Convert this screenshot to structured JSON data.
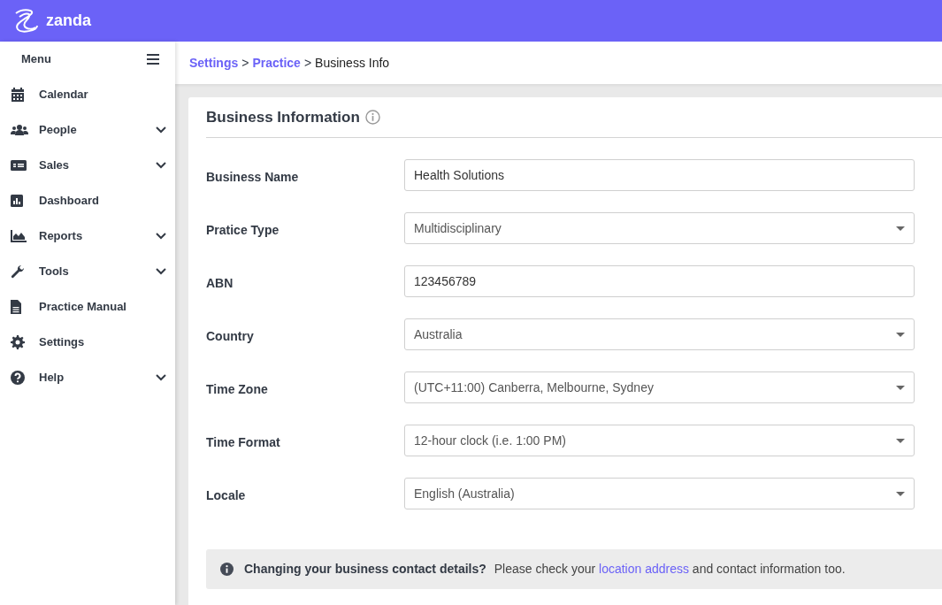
{
  "app": {
    "logo_text": "zanda"
  },
  "sidebar": {
    "title": "Menu",
    "items": [
      {
        "label": "Calendar",
        "kind": "link"
      },
      {
        "label": "People",
        "kind": "group"
      },
      {
        "label": "Sales",
        "kind": "group"
      },
      {
        "label": "Dashboard",
        "kind": "link"
      },
      {
        "label": "Reports",
        "kind": "group"
      },
      {
        "label": "Tools",
        "kind": "group"
      },
      {
        "label": "Practice Manual",
        "kind": "link"
      },
      {
        "label": "Settings",
        "kind": "link"
      },
      {
        "label": "Help",
        "kind": "group"
      }
    ]
  },
  "breadcrumb_separator": ">",
  "breadcrumb": [
    {
      "label": "Settings",
      "kind": "link"
    },
    {
      "label": "Practice",
      "kind": "link"
    },
    {
      "label": "Business Info",
      "kind": "current"
    }
  ],
  "card": {
    "title": "Business Information",
    "fields": [
      {
        "label": "Business Name",
        "kind": "text",
        "value": "Health Solutions"
      },
      {
        "label": "Pratice Type",
        "kind": "select",
        "value": "Multidisciplinary"
      },
      {
        "label": "ABN",
        "kind": "text",
        "value": "123456789"
      },
      {
        "label": "Country",
        "kind": "select",
        "value": "Australia"
      },
      {
        "label": "Time Zone",
        "kind": "select",
        "value": "(UTC+11:00) Canberra, Melbourne, Sydney"
      },
      {
        "label": "Time Format",
        "kind": "select",
        "value": "12-hour clock (i.e. 1:00 PM)"
      },
      {
        "label": "Locale",
        "kind": "select",
        "value": "English (Australia)"
      }
    ],
    "notice": {
      "lead": "Changing your business contact details?",
      "before": "Please check your",
      "link": "location address",
      "after": "and contact information too."
    }
  }
}
